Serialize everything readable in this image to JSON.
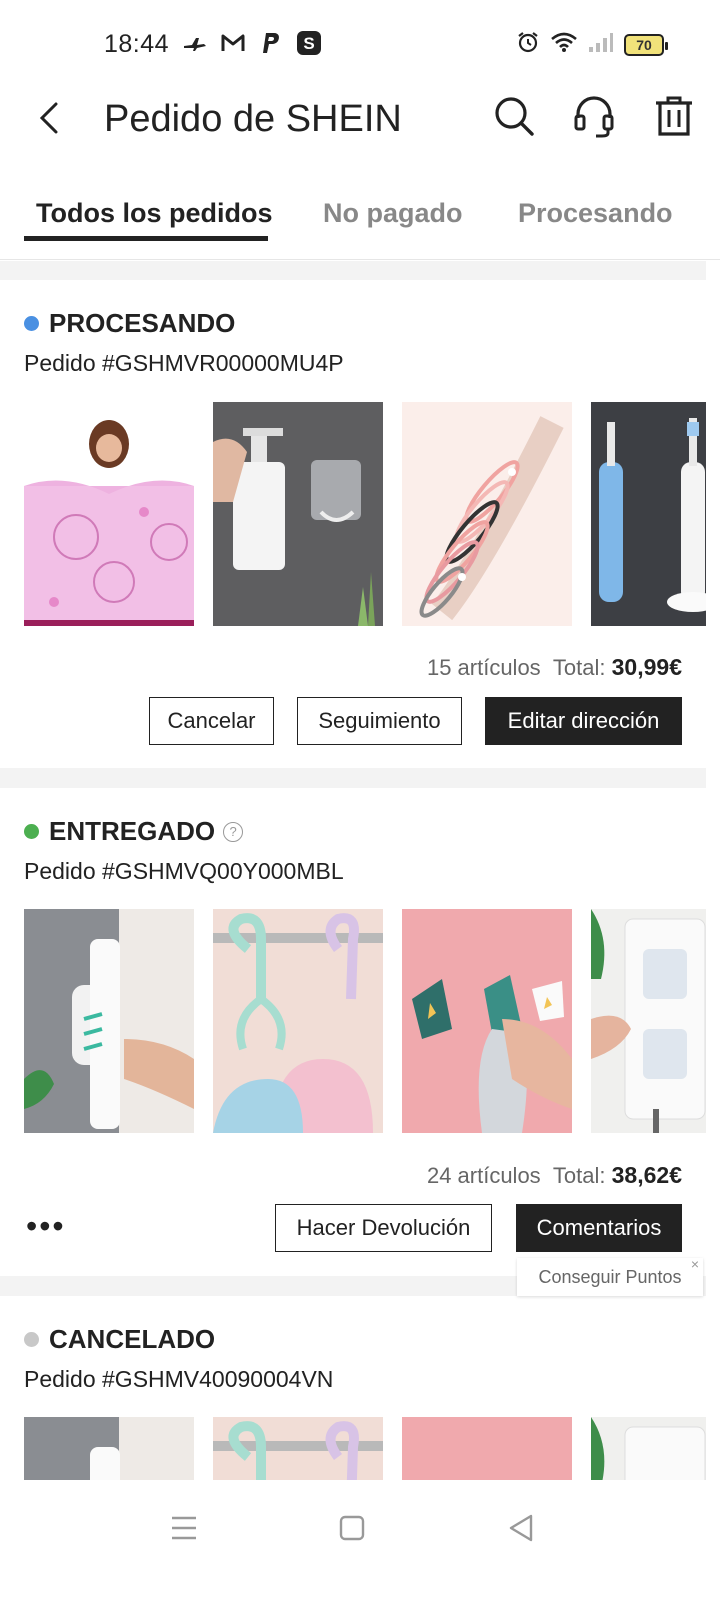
{
  "status_bar": {
    "time": "18:44",
    "battery": "70",
    "left_icons": [
      "plane-icon",
      "gmail-icon",
      "paypal-icon",
      "s-app-icon"
    ],
    "right_icons": [
      "alarm-icon",
      "wifi-icon",
      "signal-icon",
      "battery-icon"
    ]
  },
  "header": {
    "title": "Pedido de SHEIN",
    "icons": [
      "back-arrow-icon",
      "search-icon",
      "headset-icon",
      "trash-icon"
    ]
  },
  "tabs": [
    {
      "label": "Todos los pedidos",
      "active": true
    },
    {
      "label": "No pagado",
      "active": false
    },
    {
      "label": "Procesando",
      "active": false
    }
  ],
  "orders": [
    {
      "status": "PROCESANDO",
      "status_color": "#4a90e2",
      "order_number": "Pedido #GSHMVR00000MU4P",
      "items_count": "15 artículos",
      "total_label": "Total:",
      "total": "30,99€",
      "buttons": [
        "Cancelar",
        "Seguimiento",
        "Editar dirección"
      ]
    },
    {
      "status": "ENTREGADO",
      "status_color": "#4caf50",
      "help_icon": "?",
      "order_number": "Pedido #GSHMVQ00Y000MBL",
      "items_count": "24 artículos",
      "total_label": "Total:",
      "total": "38,62€",
      "more": "•••",
      "buttons": [
        "Hacer Devolución",
        "Comentarios"
      ],
      "tooltip": "Conseguir Puntos",
      "tooltip_close": "×"
    },
    {
      "status": "CANCELADO",
      "status_color": "#c8c8c8",
      "order_number": "Pedido #GSHMV40090004VN"
    }
  ],
  "nav": [
    "menu-icon",
    "home-square-icon",
    "back-triangle-icon"
  ]
}
